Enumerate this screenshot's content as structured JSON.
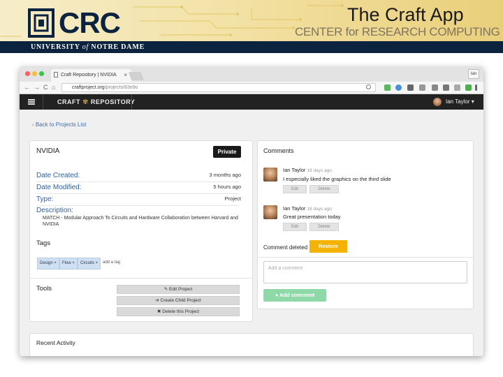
{
  "slide": {
    "title": "The Craft App",
    "logo_text": "CRC",
    "center_text": "CENTER for RESEARCH COMPUTING",
    "university_pre": "UNIVERSITY ",
    "university_of": "of",
    "university_post": " NOTRE DAME"
  },
  "browser": {
    "tab_title": "Craft Repository | NVIDIA",
    "tab_close": "×",
    "user_chip": "Ian",
    "url_host": "craftproject.org",
    "url_path": "/projects/83e9u",
    "nav_back": "←",
    "nav_forward": "→",
    "nav_reload": "C",
    "nav_home": "⌂"
  },
  "app": {
    "brand_left": "CRAFT",
    "brand_right": "REPOSITORY",
    "user_name": "Ian Taylor",
    "back_link": "Back to Projects List",
    "project": {
      "name": "NVIDIA",
      "visibility": "Private",
      "date_created_label": "Date Created:",
      "date_created": "3 months ago",
      "date_modified_label": "Date Modified:",
      "date_modified": "5 hours ago",
      "type_label": "Type:",
      "type": "Project",
      "description_label": "Description:",
      "description": "MATCH - Modular Approach To Circuits and Hardware Collaboration between Harvard and NVIDIA",
      "tags_label": "Tags",
      "tags": [
        "Design ×",
        "Flow ×",
        "Circuits ×"
      ],
      "add_tag": "add a tag",
      "tools_label": "Tools",
      "edit_btn": "Edit Project",
      "child_btn": "Create Child Project",
      "delete_btn": "Delete this Project"
    },
    "comments": {
      "header": "Comments",
      "items": [
        {
          "author": "Ian Taylor",
          "time": "18 days ago",
          "text": "I especially liked the graphics on the third slide",
          "edit": "Edit",
          "delete": "Delete"
        },
        {
          "author": "Ian Taylor",
          "time": "18 days ago",
          "text": "Great presentation today",
          "edit": "Edit",
          "delete": "Delete"
        }
      ],
      "deleted_text": "Comment deleted",
      "restore": "Restore",
      "input_placeholder": "Add a comment",
      "add_button": "Add comment"
    },
    "recent_activity": "Recent Activity"
  },
  "colors": {
    "navy": "#0c2340",
    "link_blue": "#2c5fa6",
    "restore_yellow": "#f5b301",
    "add_comment_green": "#8fd8a8"
  }
}
